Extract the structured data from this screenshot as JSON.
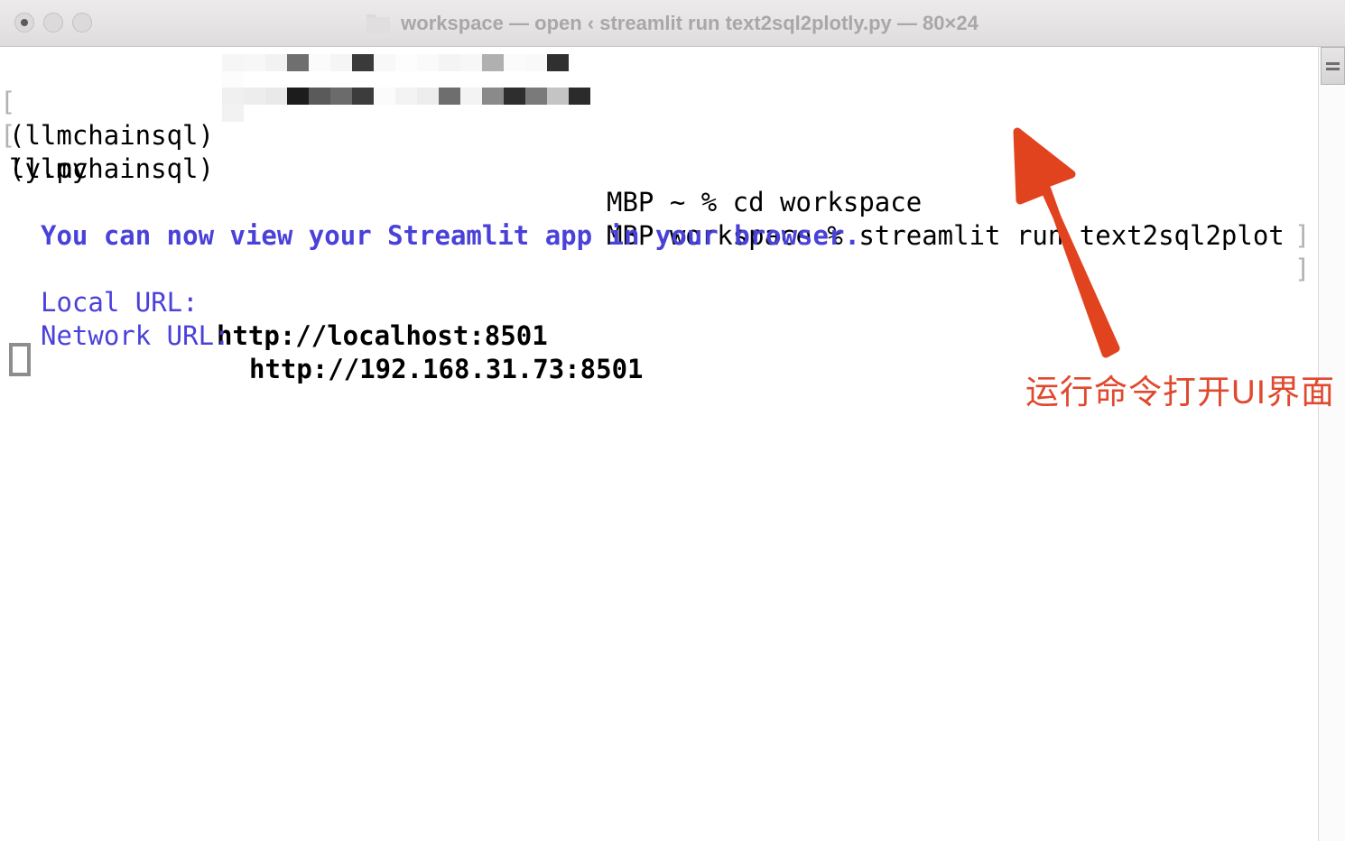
{
  "window": {
    "title": "workspace — open ‹ streamlit run text2sql2plotly.py — 80×24",
    "folder_icon": "folder-icon",
    "traffic_lights": [
      {
        "name": "close",
        "label": "Close"
      },
      {
        "name": "minimize",
        "label": "Minimize"
      },
      {
        "name": "zoom",
        "label": "Zoom"
      }
    ]
  },
  "terminal": {
    "wrap_marker_left": "[",
    "wrap_marker_right": "]",
    "lines": [
      {
        "prompt_env": "(llmchainsql)",
        "host_suffix": "MBP ~ % cd workspace"
      },
      {
        "prompt_env": "(llmchainsql)",
        "host_suffix": "MBP workspace % streamlit run text2sql2plot"
      }
    ],
    "continuation": "ly.py",
    "streamlit_banner": "You can now view your Streamlit app in your browser.",
    "local_url_label": "Local URL: ",
    "local_url_value": "http://localhost:8501",
    "network_url_label": "Network URL: ",
    "network_url_value": "http://192.168.31.73:8501",
    "cursor": "block-cursor",
    "colors": {
      "text": "#000000",
      "accent": "#4a41d8",
      "wrap_marker": "#b3b1b1",
      "cursor": "#8e8c8c"
    }
  },
  "scrollbar": {
    "thumb": "scroll-thumb"
  },
  "annotation": {
    "text": "运行命令打开UI界面",
    "arrow": "up-left-arrow",
    "color": "#e0492e"
  }
}
